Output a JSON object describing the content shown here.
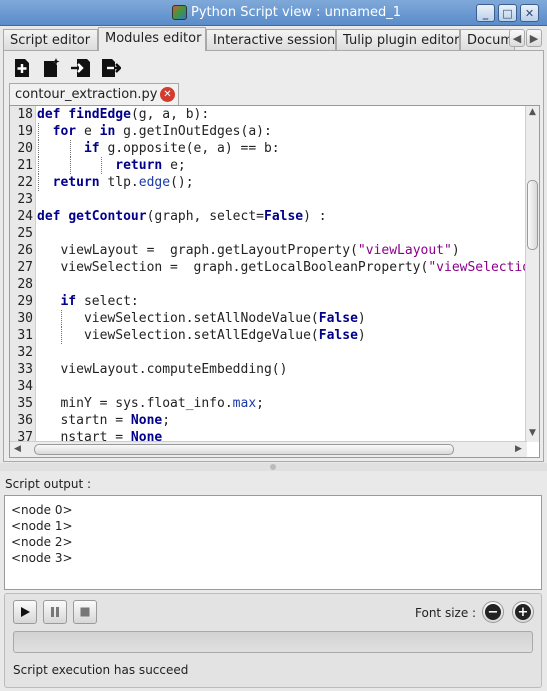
{
  "window": {
    "title": "Python Script view : unnamed_1"
  },
  "tabs": [
    {
      "label": "Script editor"
    },
    {
      "label": "Modules editor"
    },
    {
      "label": "Interactive session"
    },
    {
      "label": "Tulip plugin editor"
    },
    {
      "label": "Docum"
    }
  ],
  "toolbar": {
    "icons": [
      "new-module-icon",
      "new-file-icon",
      "load-module-icon",
      "save-module-icon"
    ]
  },
  "file_tab": {
    "name": "contour_extraction.py"
  },
  "editor": {
    "line_numbers": [
      "18",
      "19",
      "20",
      "21",
      "22",
      "23",
      "24",
      "25",
      "26",
      "27",
      "28",
      "29",
      "30",
      "31",
      "32",
      "33",
      "34",
      "35",
      "36",
      "37"
    ]
  },
  "output": {
    "label": "Script output :",
    "lines": [
      "<node 0>",
      "<node 1>",
      "<node 2>",
      "<node 3>"
    ]
  },
  "controls": {
    "font_size_label": "Font size :",
    "status": "Script execution has succeed"
  }
}
